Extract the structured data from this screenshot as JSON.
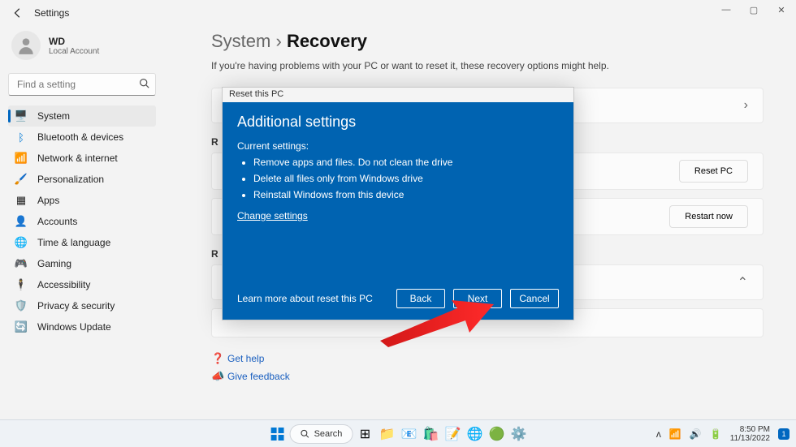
{
  "titlebar": {
    "title": "Settings"
  },
  "user": {
    "name": "WD",
    "sub": "Local Account"
  },
  "search": {
    "placeholder": "Find a setting"
  },
  "nav": {
    "items": [
      {
        "label": "System"
      },
      {
        "label": "Bluetooth & devices"
      },
      {
        "label": "Network & internet"
      },
      {
        "label": "Personalization"
      },
      {
        "label": "Apps"
      },
      {
        "label": "Accounts"
      },
      {
        "label": "Time & language"
      },
      {
        "label": "Gaming"
      },
      {
        "label": "Accessibility"
      },
      {
        "label": "Privacy & security"
      },
      {
        "label": "Windows Update"
      }
    ]
  },
  "breadcrumb": {
    "parent": "System",
    "sep": "›",
    "current": "Recovery"
  },
  "description": "If you're having problems with your PC or want to reset it, these recovery options might help.",
  "cards": {
    "section2_stub": "R",
    "section3_stub": "R",
    "reset_pc_btn": "Reset PC",
    "restart_now_btn": "Restart now"
  },
  "modal": {
    "frame_title": "Reset this PC",
    "heading": "Additional settings",
    "current_label": "Current settings:",
    "bullets": [
      "Remove apps and files. Do not clean the drive",
      "Delete all files only from Windows drive",
      "Reinstall Windows from this device"
    ],
    "change_link": "Change settings",
    "learn_more": "Learn more about reset this PC",
    "back": "Back",
    "next": "Next",
    "cancel": "Cancel"
  },
  "help": {
    "get_help": "Get help",
    "feedback": "Give feedback"
  },
  "taskbar": {
    "search": "Search"
  },
  "tray": {
    "time": "8:50 PM",
    "date": "11/13/2022",
    "notif": "1"
  }
}
